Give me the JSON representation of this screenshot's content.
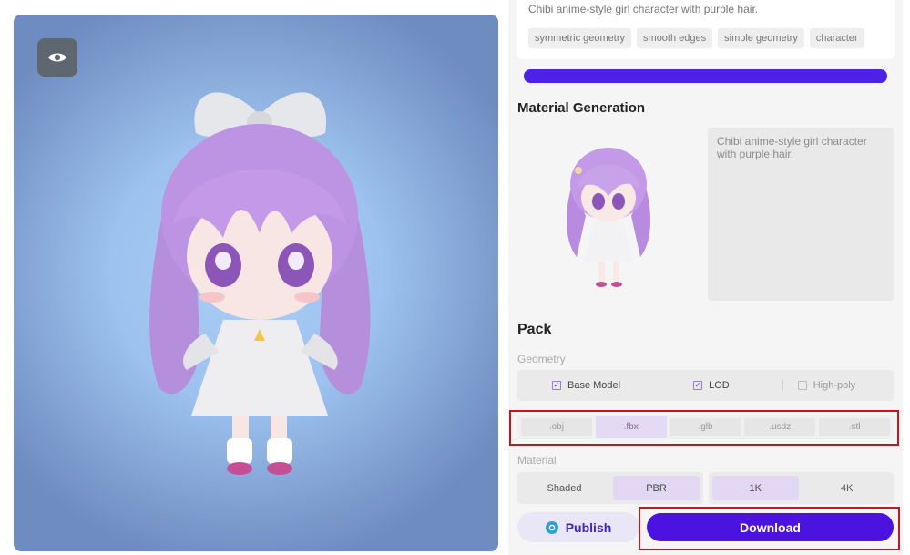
{
  "viewer": {
    "eye_icon": "eye-icon",
    "background_color": "#a9cdf4"
  },
  "prompt": {
    "text": "Chibi anime-style girl character with purple hair.",
    "tags": [
      "symmetric geometry",
      "smooth edges",
      "simple geometry",
      "character"
    ]
  },
  "progress": {
    "value": 1.0,
    "color": "#4b22e6"
  },
  "material_generation": {
    "title": "Material Generation",
    "description": "Chibi anime-style girl character with purple hair."
  },
  "pack": {
    "title": "Pack",
    "geometry_label": "Geometry",
    "geometry_options": [
      {
        "label": "Base Model",
        "checked": true
      },
      {
        "label": "LOD",
        "checked": true
      },
      {
        "label": "High-poly",
        "checked": false
      }
    ],
    "formats": [
      ".obj",
      ".fbx",
      ".glb",
      ".usdz",
      ".stl"
    ],
    "selected_format": ".fbx",
    "material_label": "Material",
    "shading_options": [
      "Shaded",
      "PBR"
    ],
    "selected_shading": "PBR",
    "resolution_options": [
      "1K",
      "4K"
    ],
    "selected_resolution": "1K"
  },
  "actions": {
    "publish_label": "Publish",
    "download_label": "Download",
    "accent_color": "#4b12e0",
    "highlight_color": "#c8141c"
  }
}
